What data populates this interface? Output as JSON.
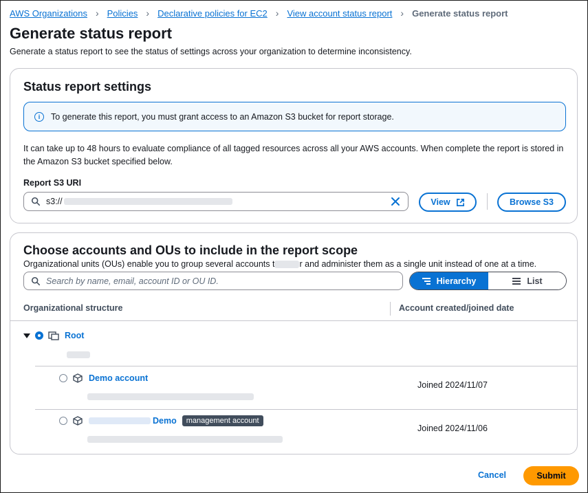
{
  "breadcrumb": {
    "items": [
      "AWS Organizations",
      "Policies",
      "Declarative policies for EC2",
      "View account status report"
    ],
    "current": "Generate status report"
  },
  "page": {
    "title": "Generate status report",
    "description": "Generate a status report to see the status of settings across your organization to determine inconsistency."
  },
  "settings": {
    "title": "Status report settings",
    "alert": "To generate this report, you must grant access to an Amazon S3 bucket for report storage.",
    "body": "It can take up to 48 hours to evaluate compliance of all tagged resources across all your AWS accounts. When complete the report is stored in the Amazon S3 bucket specified below.",
    "field_label": "Report S3 URI",
    "uri_prefix": "s3://",
    "view_label": "View",
    "browse_label": "Browse S3"
  },
  "scope": {
    "title": "Choose accounts and OUs to include in the report scope",
    "desc_part1": "Organizational units (OUs) enable you to group several accounts t",
    "desc_part2": "r and administer them as a single unit instead of one at a time.",
    "search_placeholder": "Search by name, email, account ID or OU ID.",
    "toggle_hierarchy": "Hierarchy",
    "toggle_list": "List",
    "col_structure": "Organizational structure",
    "col_date": "Account created/joined date",
    "root_label": "Root",
    "accounts": [
      {
        "name": "Demo account",
        "joined": "Joined 2024/11/07"
      },
      {
        "name": "Demo",
        "tag": "management account",
        "joined": "Joined 2024/11/06"
      }
    ]
  },
  "footer": {
    "cancel": "Cancel",
    "submit": "Submit"
  },
  "colors": {
    "link": "#0972d3",
    "primary_button": "#ff9900",
    "border": "#c6c6cd"
  }
}
